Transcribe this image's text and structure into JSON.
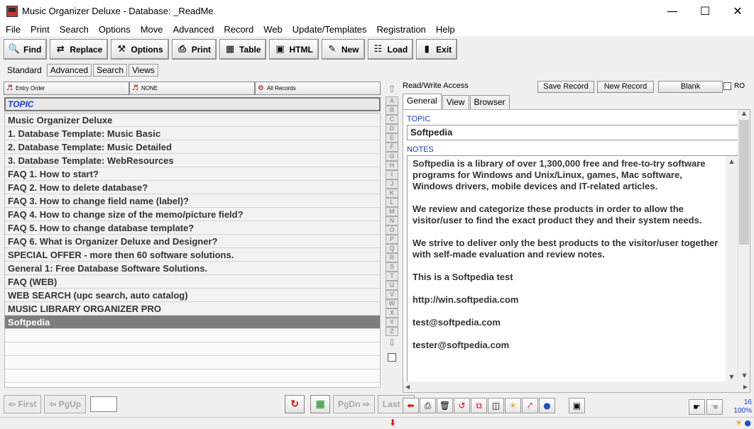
{
  "window": {
    "title": "Music Organizer Deluxe - Database: _ReadMe",
    "minimize": "—",
    "maximize": "☐",
    "close": "✕"
  },
  "menu": [
    "File",
    "Print",
    "Search",
    "Options",
    "Move",
    "Advanced",
    "Record",
    "Web",
    "Update/Templates",
    "Registration",
    "Help"
  ],
  "toolbar": [
    {
      "label": "Find",
      "icon": "find-icon",
      "glyph": "🔍"
    },
    {
      "label": "Replace",
      "icon": "replace-icon",
      "glyph": "⇄"
    },
    {
      "label": "Options",
      "icon": "options-icon",
      "glyph": "⚒"
    },
    {
      "label": "Print",
      "icon": "printer-icon",
      "glyph": "⎙"
    },
    {
      "label": "Table",
      "icon": "table-icon",
      "glyph": "▦"
    },
    {
      "label": "HTML",
      "icon": "html-icon",
      "glyph": "▣"
    },
    {
      "label": "New",
      "icon": "new-icon",
      "glyph": "✎"
    },
    {
      "label": "Load",
      "icon": "load-icon",
      "glyph": "☷"
    },
    {
      "label": "Exit",
      "icon": "exit-icon",
      "glyph": "▮"
    }
  ],
  "view_tabs": [
    "Standard",
    "Advanced",
    "Search",
    "Views"
  ],
  "sort_bar": {
    "order": "Entry Order",
    "filter": "NONE",
    "records": "All Records"
  },
  "list": {
    "header": "TOPIC",
    "records": [
      "Music Organizer Deluxe",
      "1. Database Template: Music Basic",
      "2. Database Template: Music Detailed",
      "3. Database Template: WebResources",
      "FAQ 1. How to start?",
      "FAQ 2. How to delete database?",
      "FAQ 3. How to change field name (label)?",
      "FAQ 4. How to change size of the memo/picture field?",
      "FAQ 5. How to change database template?",
      "FAQ 6. What is Organizer Deluxe and Designer?",
      "SPECIAL OFFER - more then 60 software solutions.",
      "General 1: Free Database Software Solutions.",
      "FAQ (WEB)",
      "WEB SEARCH (upc search, auto catalog)",
      "MUSIC LIBRARY ORGANIZER PRO",
      "Softpedia"
    ],
    "selected_index": 15
  },
  "alphabet": [
    "A",
    "B",
    "C",
    "D",
    "E",
    "F",
    "G",
    "H",
    "I",
    "J",
    "K",
    "L",
    "M",
    "N",
    "O",
    "P",
    "Q",
    "R",
    "S",
    "T",
    "U",
    "V",
    "W",
    "X",
    "Y",
    "Z"
  ],
  "nav": {
    "first": "First",
    "pgup": "PgUp",
    "pgdn": "PgDn",
    "last": "Last",
    "goto_value": ""
  },
  "record_panel": {
    "access": "Read/Write Access",
    "save_record": "Save Record",
    "new_record": "New Record",
    "blank": "Blank",
    "ro": "RO",
    "tabs": [
      "General",
      "View",
      "Browser"
    ],
    "topic_label": "TOPIC",
    "topic_value": "Softpedia",
    "notes_label": "NOTES",
    "notes": [
      "Softpedia is a library of over 1,300,000 free and free-to-try software programs for Windows and Unix/Linux, games, Mac software, Windows drivers, mobile devices and IT-related articles.",
      "We review and categorize these products in order to allow the visitor/user to find the exact product they and their system needs.",
      "We strive to deliver only the best products to the visitor/user together with self-made evaluation and review notes.",
      "This is a Softpedia test",
      "http://win.softpedia.com",
      "test@softpedia.com",
      "tester@softpedia.com"
    ]
  },
  "stats": {
    "count": "16",
    "zoom": "100%"
  },
  "colors": {
    "accent_blue": "#1a3fc4",
    "selected_row": "#7d7d7d",
    "red_arrow": "#e00000"
  }
}
